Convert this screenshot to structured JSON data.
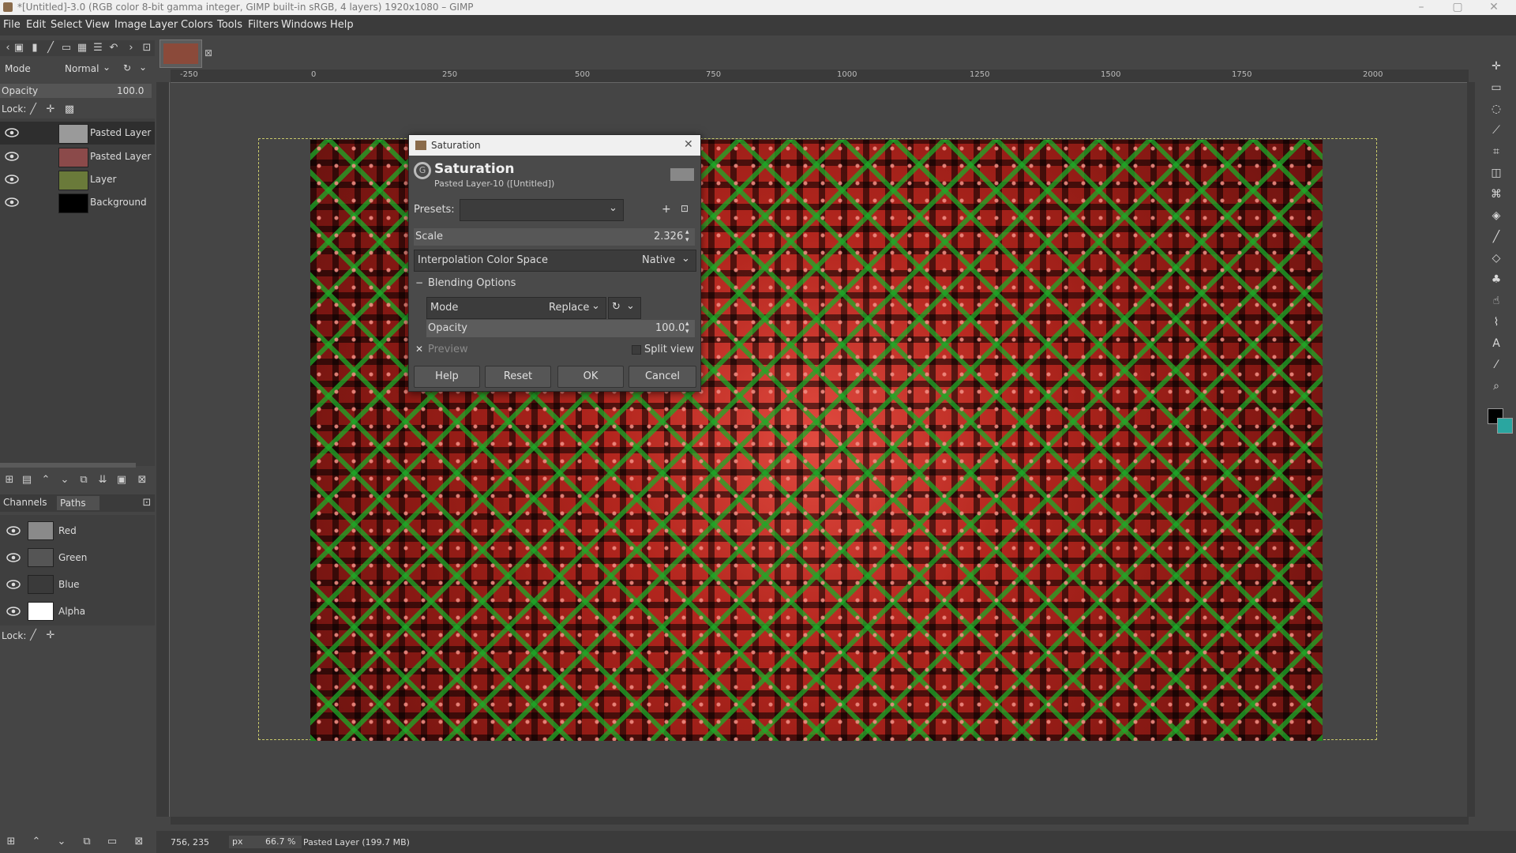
{
  "window": {
    "title": "*[Untitled]-3.0 (RGB color 8-bit gamma integer, GIMP built-in sRGB, 4 layers) 1920x1080 – GIMP",
    "minimize": "–",
    "maximize": "▢",
    "close": "✕"
  },
  "menu": [
    "File",
    "Edit",
    "Select",
    "View",
    "Image",
    "Layer",
    "Colors",
    "Tools",
    "Filters",
    "Windows",
    "Help"
  ],
  "layers_panel": {
    "mode_label": "Mode",
    "mode_value": "Normal",
    "opacity_label": "Opacity",
    "opacity_value": "100.0",
    "lock_label": "Lock:",
    "layers": [
      {
        "name": "Pasted Layer",
        "thumb_color": "#9a9a9a",
        "active": true
      },
      {
        "name": "Pasted Layer",
        "thumb_color": "#8b4a4a",
        "active": false
      },
      {
        "name": "Layer",
        "thumb_color": "#6a7a3a",
        "active": false
      },
      {
        "name": "Background",
        "thumb_color": "#000000",
        "active": false
      }
    ]
  },
  "channels_panel": {
    "tab_channels": "Channels",
    "tab_paths": "Paths",
    "lock_label": "Lock:",
    "channels": [
      {
        "name": "Red",
        "thumb_color": "#8a8a8a"
      },
      {
        "name": "Green",
        "thumb_color": "#555555"
      },
      {
        "name": "Blue",
        "thumb_color": "#3a3a3a"
      },
      {
        "name": "Alpha",
        "thumb_color": "#ffffff"
      }
    ]
  },
  "ruler": {
    "h_labels": [
      "-250",
      "0",
      "250",
      "500",
      "750",
      "1000",
      "1250",
      "1500",
      "1750",
      "2000"
    ]
  },
  "dialog": {
    "window_title": "Saturation",
    "heading": "Saturation",
    "subheading": "Pasted Layer-10 ([Untitled])",
    "presets_label": "Presets:",
    "presets_value": "",
    "scale_label": "Scale",
    "scale_value": "2.326",
    "interp_label": "Interpolation Color Space",
    "interp_value": "Native",
    "blending_label": "Blending Options",
    "mode_label": "Mode",
    "mode_value": "Replace",
    "opacity_label": "Opacity",
    "opacity_value": "100.0",
    "preview_label": "Preview",
    "splitview_label": "Split view",
    "help": "Help",
    "reset": "Reset",
    "ok": "OK",
    "cancel": "Cancel"
  },
  "status": {
    "coords": "756, 235",
    "unit": "px",
    "zoom": "66.7 %",
    "message": "Pasted Layer (199.7 MB)"
  },
  "colors": {
    "bg": "#454545",
    "panel_dark": "#3b3b3b",
    "artwork_red": "#b3261e",
    "artwork_green": "#1eaa28",
    "fg_color": "#000000",
    "bg_color": "#2aa6a0"
  }
}
